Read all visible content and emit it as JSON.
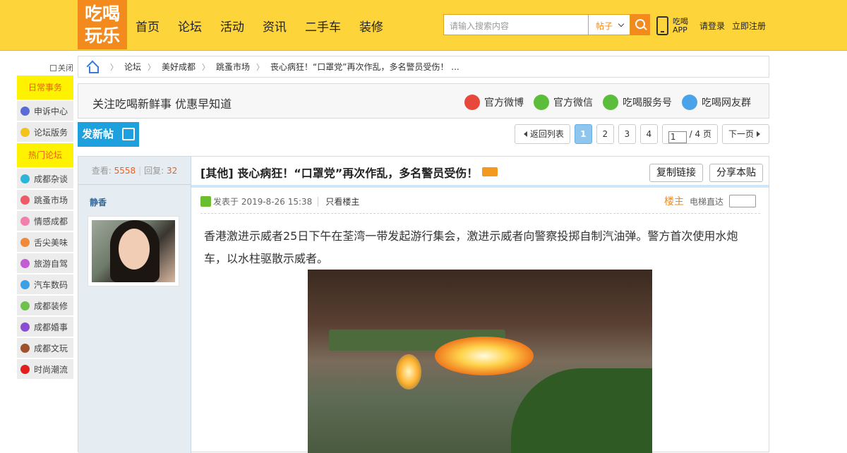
{
  "header": {
    "logo_line1": "吃喝",
    "logo_line2": "玩乐",
    "nav": [
      "首页",
      "论坛",
      "活动",
      "资讯",
      "二手车",
      "装修"
    ],
    "search_placeholder": "请输入搜索内容",
    "search_type": "帖子",
    "app_line1": "吃喝",
    "app_line2": "APP",
    "login": "请登录",
    "register": "立即注册"
  },
  "sidebar": {
    "close": "关闭",
    "cat1": "日常事务",
    "items1": [
      {
        "label": "申诉中心",
        "color": "#5b6bd6"
      },
      {
        "label": "论坛版务",
        "color": "#f3c21b"
      }
    ],
    "cat2": "热门论坛",
    "items2": [
      {
        "label": "成都杂谈",
        "color": "#2bb6d9"
      },
      {
        "label": "跳蚤市场",
        "color": "#ef5a66"
      },
      {
        "label": "情感成都",
        "color": "#f27fae"
      },
      {
        "label": "舌尖美味",
        "color": "#f08a3a"
      },
      {
        "label": "旅游自驾",
        "color": "#c35ad6"
      },
      {
        "label": "汽车数码",
        "color": "#3aa1e6"
      },
      {
        "label": "成都装修",
        "color": "#6cc24a"
      },
      {
        "label": "成都婚事",
        "color": "#8a4fd0"
      },
      {
        "label": "成都文玩",
        "color": "#a0522d"
      },
      {
        "label": "时尚潮流",
        "color": "#e02020"
      }
    ]
  },
  "breadcrumb": [
    "论坛",
    "美好成都",
    "跳蚤市场",
    "丧心病狂！“口罩党”再次作乱，多名警员受伤！ ..."
  ],
  "follow": {
    "text": "关注吃喝新鲜事 优惠早知道",
    "links": [
      {
        "label": "官方微博",
        "color": "#e8473c"
      },
      {
        "label": "官方微信",
        "color": "#5bbd3a"
      },
      {
        "label": "吃喝服务号",
        "color": "#5bbd3a"
      },
      {
        "label": "吃喝网友群",
        "color": "#4aa3e8"
      }
    ]
  },
  "actions": {
    "new_post": "发新帖",
    "back": "返回列表",
    "pages": [
      "1",
      "2",
      "3",
      "4"
    ],
    "current_page_input": "1",
    "total_pages": "/ 4 页",
    "next": "下一页"
  },
  "post": {
    "views_label": "查看:",
    "views": "5558",
    "replies_label": "回复:",
    "replies": "32",
    "author": "静香",
    "title": "[其他] 丧心病狂！“口罩党”再次作乱，多名警员受伤！",
    "copy_link": "复制链接",
    "share": "分享本贴",
    "posted": "发表于 2019-8-26 15:38",
    "only_author": "只看楼主",
    "louzhu": "楼主",
    "elevator": "电梯直达",
    "body": "香港激进示威者25日下午在荃湾一带发起游行集会，激进示威者向警察投掷自制汽油弹。警方首次使用水炮车，以水柱驱散示威者。"
  }
}
